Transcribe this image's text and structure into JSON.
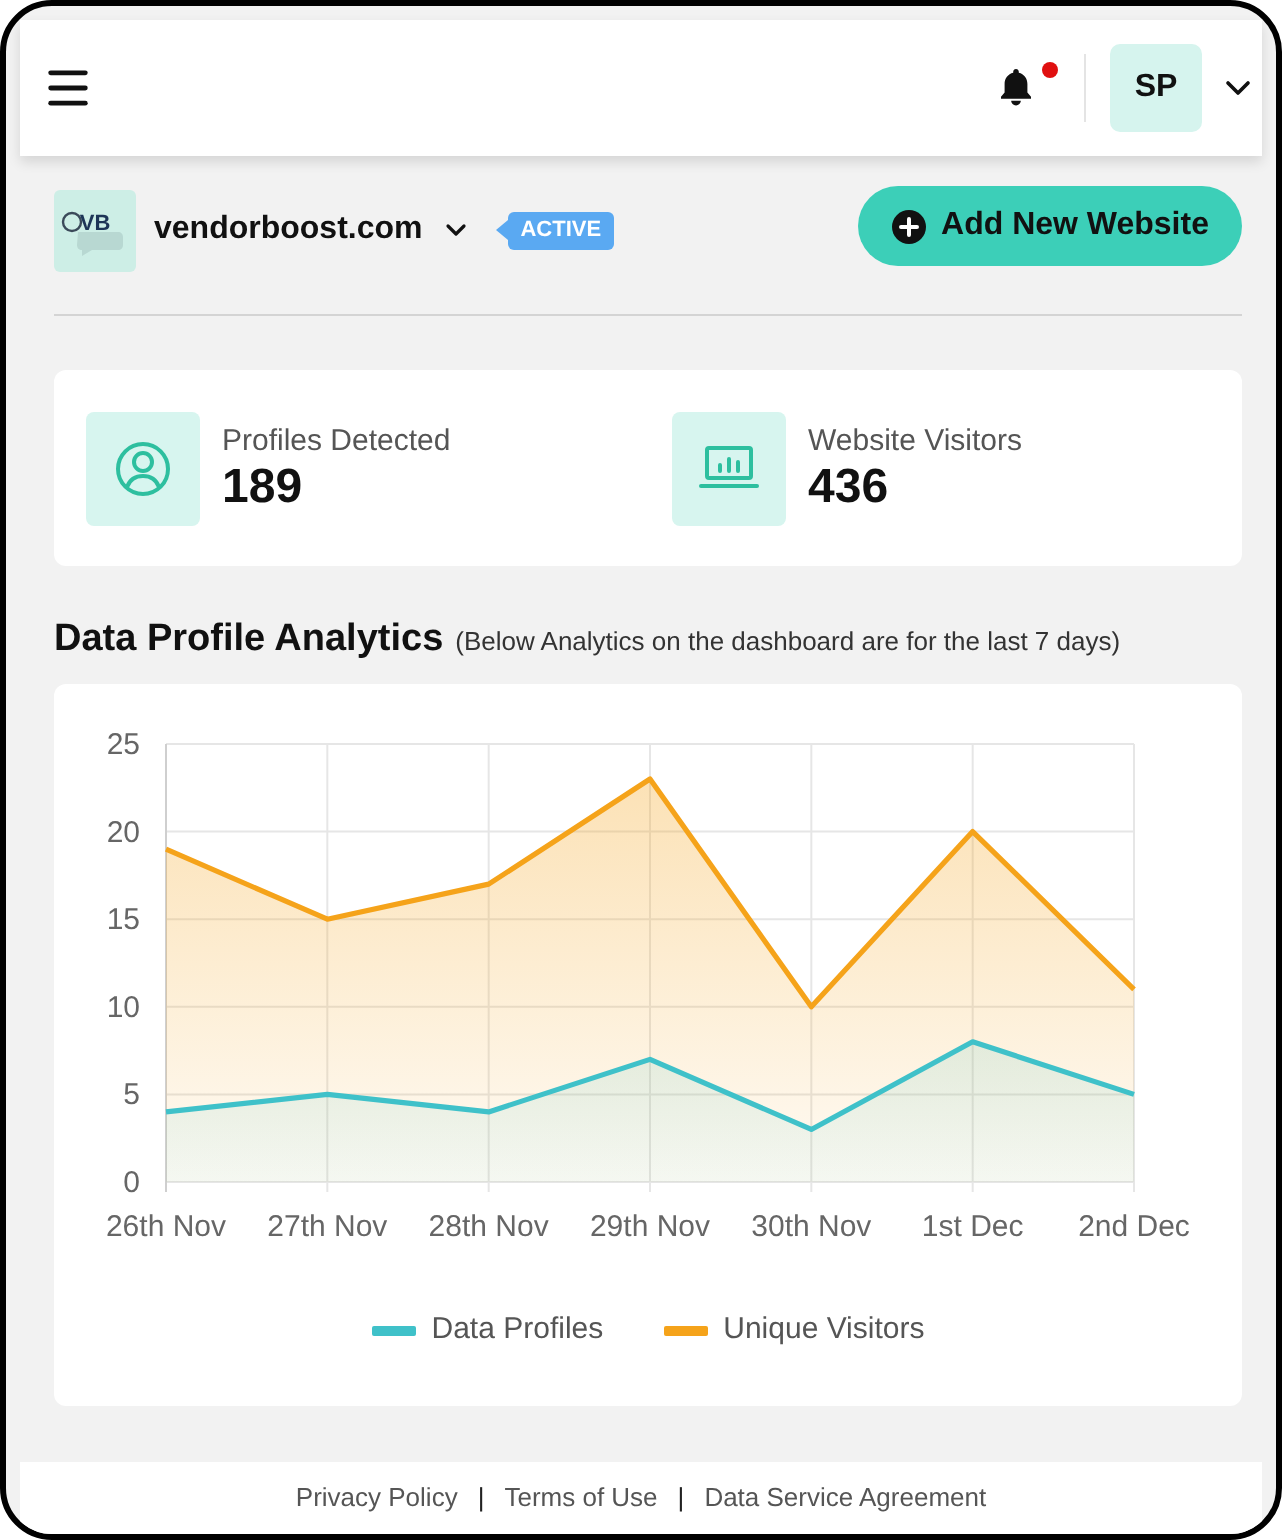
{
  "header": {
    "notification_dot": true,
    "avatar_initials": "SP"
  },
  "website": {
    "logo_text": "VB",
    "name": "vendorboost.com",
    "status": "ACTIVE"
  },
  "add_button": {
    "label": "Add New Website"
  },
  "stats": [
    {
      "kind": "profiles",
      "label": "Profiles Detected",
      "value": "189"
    },
    {
      "kind": "visitors",
      "label": "Website Visitors",
      "value": "436"
    }
  ],
  "analytics": {
    "title": "Data Profile Analytics",
    "subtitle": "(Below Analytics on the dashboard are for the last 7 days)",
    "chart_data": {
      "type": "area",
      "categories": [
        "26th Nov",
        "27th Nov",
        "28th Nov",
        "29th Nov",
        "30th Nov",
        "1st Dec",
        "2nd Dec"
      ],
      "series": [
        {
          "name": "Data Profiles",
          "color": "#3fc1c9",
          "values": [
            4,
            5,
            4,
            7,
            3,
            8,
            5
          ]
        },
        {
          "name": "Unique Visitors",
          "color": "#f5a31a",
          "values": [
            19,
            15,
            17,
            23,
            10,
            20,
            11
          ]
        }
      ],
      "ylim": [
        0,
        25
      ],
      "yticks": [
        0,
        5,
        10,
        15,
        20,
        25
      ],
      "grid": true,
      "legend": true
    }
  },
  "footer": [
    {
      "kind": "link",
      "label": "Privacy Policy"
    },
    {
      "kind": "separator",
      "label": "|"
    },
    {
      "kind": "link",
      "label": "Terms of Use"
    },
    {
      "kind": "separator",
      "label": "|"
    },
    {
      "kind": "link",
      "label": "Data Service Agreement"
    }
  ]
}
